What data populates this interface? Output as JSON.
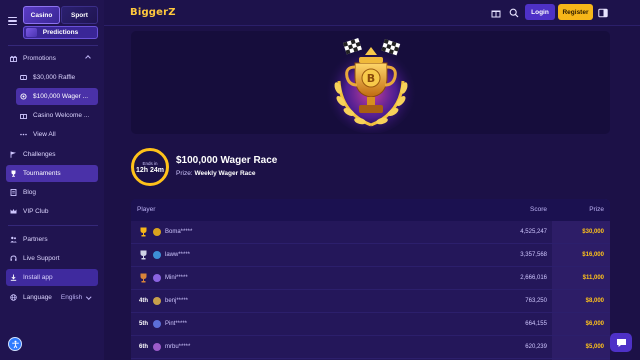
{
  "sidebar": {
    "switch_casino": "Casino",
    "switch_sport": "Sport",
    "predictions": "Predictions",
    "items": [
      {
        "label": "Promotions",
        "icon": "gift-icon"
      },
      {
        "label": "$30,000 Raffle",
        "icon": "ticket-icon"
      },
      {
        "label": "$100,000 Wager ...",
        "icon": "gear-icon"
      },
      {
        "label": "Casino Welcome ...",
        "icon": "gift-icon"
      },
      {
        "label": "View All",
        "icon": "dots-icon"
      },
      {
        "label": "Challenges",
        "icon": "flag-icon"
      },
      {
        "label": "Tournaments",
        "icon": "trophy-icon"
      },
      {
        "label": "Blog",
        "icon": "document-icon"
      },
      {
        "label": "VIP Club",
        "icon": "crown-icon"
      },
      {
        "label": "Partners",
        "icon": "users-icon"
      },
      {
        "label": "Live Support",
        "icon": "headset-icon"
      },
      {
        "label": "Install app",
        "icon": "download-icon"
      }
    ],
    "language_label": "Language",
    "language_value": "English"
  },
  "header": {
    "logo": "BiggerZ",
    "login": "Login",
    "register": "Register"
  },
  "race": {
    "timer_label": "Ends in",
    "timer_value": "12h 24m",
    "title": "$100,000 Wager Race",
    "prize_label": "Prize:",
    "prize_value": "Weekly Wager Race"
  },
  "leaderboard": {
    "columns": {
      "player": "Player",
      "score": "Score",
      "prize": "Prize"
    },
    "rows": [
      {
        "rank": "",
        "medal": "gold",
        "name": "Boma*****",
        "score": "4,525,247",
        "prize": "$30,000",
        "avatar": "#d9a31e"
      },
      {
        "rank": "",
        "medal": "silver",
        "name": "laww*****",
        "score": "3,357,568",
        "prize": "$16,000",
        "avatar": "#3d8fd6"
      },
      {
        "rank": "",
        "medal": "bronze",
        "name": "Mini*****",
        "score": "2,666,016",
        "prize": "$11,000",
        "avatar": "#8a63e0"
      },
      {
        "rank": "4th",
        "medal": "",
        "name": "benj*****",
        "score": "763,250",
        "prize": "$8,000",
        "avatar": "#c7a04b"
      },
      {
        "rank": "5th",
        "medal": "",
        "name": "Pint*****",
        "score": "664,155",
        "prize": "$6,000",
        "avatar": "#5c6fd8"
      },
      {
        "rank": "6th",
        "medal": "",
        "name": "mrbu*****",
        "score": "620,239",
        "prize": "$5,000",
        "avatar": "#9c5bc9"
      }
    ]
  },
  "colors": {
    "accent": "#4e31c7",
    "gold": "#ffc21a",
    "background": "#1c1147"
  }
}
